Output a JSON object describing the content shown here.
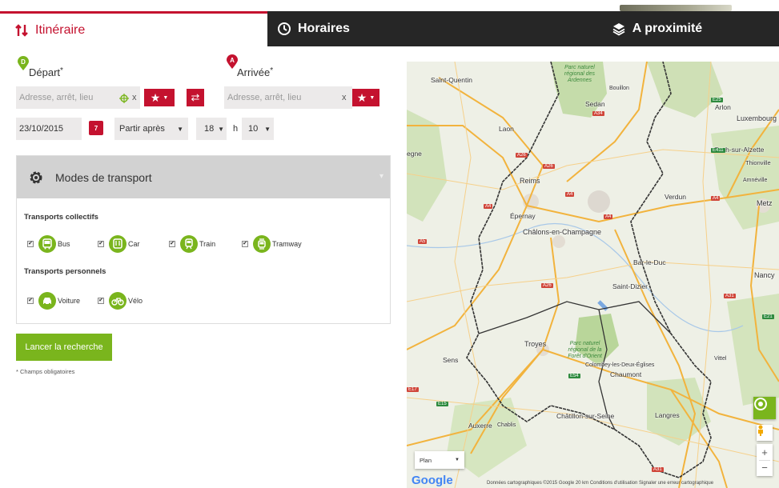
{
  "tabs": {
    "itineraire": "Itinéraire",
    "horaires": "Horaires",
    "proximite": "A proximité"
  },
  "form": {
    "depart_label": "Départ",
    "arrivee_label": "Arrivée",
    "required_mark": "*",
    "depart_placeholder": "Adresse, arrêt, lieu",
    "arrivee_placeholder": "Adresse, arrêt, lieu",
    "clear": "x",
    "date": "23/10/2015",
    "calendar_day": "7",
    "time_mode": "Partir après",
    "hour": "18",
    "h_sep": "h",
    "minute": "10"
  },
  "modes": {
    "title": "Modes de transport",
    "collectifs_title": "Transports collectifs",
    "personnels_title": "Transports personnels",
    "collectifs": [
      {
        "label": "Bus",
        "checked": true
      },
      {
        "label": "Car",
        "checked": true
      },
      {
        "label": "Train",
        "checked": true
      },
      {
        "label": "Tramway",
        "checked": true
      }
    ],
    "personnels": [
      {
        "label": "Voiture",
        "checked": true
      },
      {
        "label": "Vélo",
        "checked": true
      }
    ]
  },
  "search_button": "Lancer la recherche",
  "required_note": "* Champs obligatoires",
  "map": {
    "plan_select": "Plan",
    "google": "Google",
    "attribution": "Données cartographiques ©2015 Google   20 km      Conditions d'utilisation   Signaler une erreur cartographique",
    "cities": {
      "saint_quentin": "Saint-Quentin",
      "sedan": "Sedan",
      "bouillon": "Bouillon",
      "arlon": "Arlon",
      "luxembourg": "Luxembourg",
      "laon": "Laon",
      "esch": "Esch-sur-Alzette",
      "thionville": "Thionville",
      "amneville": "Amnéville",
      "reims": "Reims",
      "verdun": "Verdun",
      "metz": "Metz",
      "epernay": "Épernay",
      "chalons": "Châlons-en-Champagne",
      "bar_le_duc": "Bar-le-Duc",
      "saint_dizier": "Saint-Dizier",
      "nancy": "Nancy",
      "troyes": "Troyes",
      "sens": "Sens",
      "colombey": "Colombey-les-Deux-Églises",
      "chaumont": "Chaumont",
      "vittel": "Vittel",
      "langres": "Langres",
      "chatillon": "Châtillon-sur-Seine",
      "auxerre": "Auxerre",
      "chablis": "Chablis",
      "egne": "egne"
    },
    "parc_ardennes": "Parc naturel régional des Ardennes",
    "parc_orient": "Parc naturel régional de la Forêt d'Orient",
    "roads": [
      "A34",
      "A26",
      "A26",
      "A4",
      "A4",
      "A4",
      "A4",
      "A26",
      "A5",
      "A31",
      "E25",
      "E411",
      "E54",
      "E15",
      "E17",
      "A31",
      "E21"
    ]
  },
  "colors": {
    "brand_red": "#c4122f",
    "brand_green": "#7ab51d",
    "tab_dark": "#262626"
  }
}
